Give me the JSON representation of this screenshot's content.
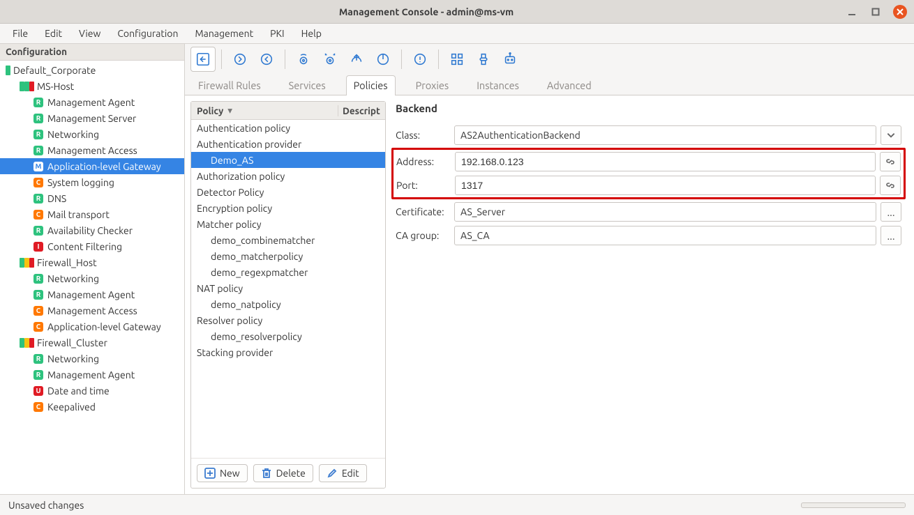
{
  "window": {
    "title": "Management Console - admin@ms-vm"
  },
  "menus": [
    "File",
    "Edit",
    "View",
    "Configuration",
    "Management",
    "PKI",
    "Help"
  ],
  "sidebar": {
    "header": "Configuration",
    "tree": [
      {
        "depth": 0,
        "kind": "group",
        "squares": [
          "green"
        ],
        "label": "Default_Corporate"
      },
      {
        "depth": 1,
        "kind": "host",
        "squares": [
          "green",
          "green",
          "red"
        ],
        "label": "MS-Host"
      },
      {
        "depth": 2,
        "kind": "comp",
        "badge": "R",
        "label": "Management Agent"
      },
      {
        "depth": 2,
        "kind": "comp",
        "badge": "R",
        "label": "Management Server"
      },
      {
        "depth": 2,
        "kind": "comp",
        "badge": "R",
        "label": "Networking"
      },
      {
        "depth": 2,
        "kind": "comp",
        "badge": "R",
        "label": "Management Access"
      },
      {
        "depth": 2,
        "kind": "comp",
        "badge": "M",
        "label": "Application-level Gateway",
        "selected": true
      },
      {
        "depth": 2,
        "kind": "comp",
        "badge": "C",
        "label": "System logging"
      },
      {
        "depth": 2,
        "kind": "comp",
        "badge": "R",
        "label": "DNS"
      },
      {
        "depth": 2,
        "kind": "comp",
        "badge": "C",
        "label": "Mail transport"
      },
      {
        "depth": 2,
        "kind": "comp",
        "badge": "R",
        "label": "Availability Checker"
      },
      {
        "depth": 2,
        "kind": "comp",
        "badge": "I",
        "label": "Content Filtering"
      },
      {
        "depth": 1,
        "kind": "host",
        "squares": [
          "green",
          "yellow",
          "red"
        ],
        "label": "Firewall_Host"
      },
      {
        "depth": 2,
        "kind": "comp",
        "badge": "R",
        "label": "Networking"
      },
      {
        "depth": 2,
        "kind": "comp",
        "badge": "R",
        "label": "Management Agent"
      },
      {
        "depth": 2,
        "kind": "comp",
        "badge": "C",
        "label": "Management Access"
      },
      {
        "depth": 2,
        "kind": "comp",
        "badge": "C",
        "label": "Application-level Gateway"
      },
      {
        "depth": 1,
        "kind": "host",
        "squares": [
          "green",
          "yellow",
          "red"
        ],
        "label": "Firewall_Cluster"
      },
      {
        "depth": 2,
        "kind": "comp",
        "badge": "R",
        "label": "Networking"
      },
      {
        "depth": 2,
        "kind": "comp",
        "badge": "R",
        "label": "Management Agent"
      },
      {
        "depth": 2,
        "kind": "comp",
        "badge": "U",
        "label": "Date and time"
      },
      {
        "depth": 2,
        "kind": "comp",
        "badge": "C",
        "label": "Keepalived"
      }
    ]
  },
  "tabs": {
    "items": [
      "Firewall Rules",
      "Services",
      "Policies",
      "Proxies",
      "Instances",
      "Advanced"
    ],
    "active": "Policies"
  },
  "policyList": {
    "header_col1": "Policy",
    "header_col2": "Descript",
    "buttons": {
      "new": "New",
      "delete": "Delete",
      "edit": "Edit"
    },
    "items": [
      {
        "label": "Authentication policy"
      },
      {
        "label": "Authentication provider"
      },
      {
        "label": "Demo_AS",
        "child": true,
        "selected": true
      },
      {
        "label": "Authorization policy"
      },
      {
        "label": "Detector Policy"
      },
      {
        "label": "Encryption policy"
      },
      {
        "label": "Matcher policy"
      },
      {
        "label": "demo_combinematcher",
        "child": true
      },
      {
        "label": "demo_matcherpolicy",
        "child": true
      },
      {
        "label": "demo_regexpmatcher",
        "child": true
      },
      {
        "label": "NAT policy"
      },
      {
        "label": "demo_natpolicy",
        "child": true
      },
      {
        "label": "Resolver policy"
      },
      {
        "label": "demo_resolverpolicy",
        "child": true
      },
      {
        "label": "Stacking provider"
      }
    ]
  },
  "details": {
    "heading": "Backend",
    "class_label": "Class:",
    "class_value": "AS2AuthenticationBackend",
    "address_label": "Address:",
    "address_value": "192.168.0.123",
    "port_label": "Port:",
    "port_value": "1317",
    "cert_label": "Certificate:",
    "cert_value": "AS_Server",
    "cagroup_label": "CA group:",
    "cagroup_value": "AS_CA",
    "dots": "..."
  },
  "status": {
    "text": "Unsaved changes"
  }
}
